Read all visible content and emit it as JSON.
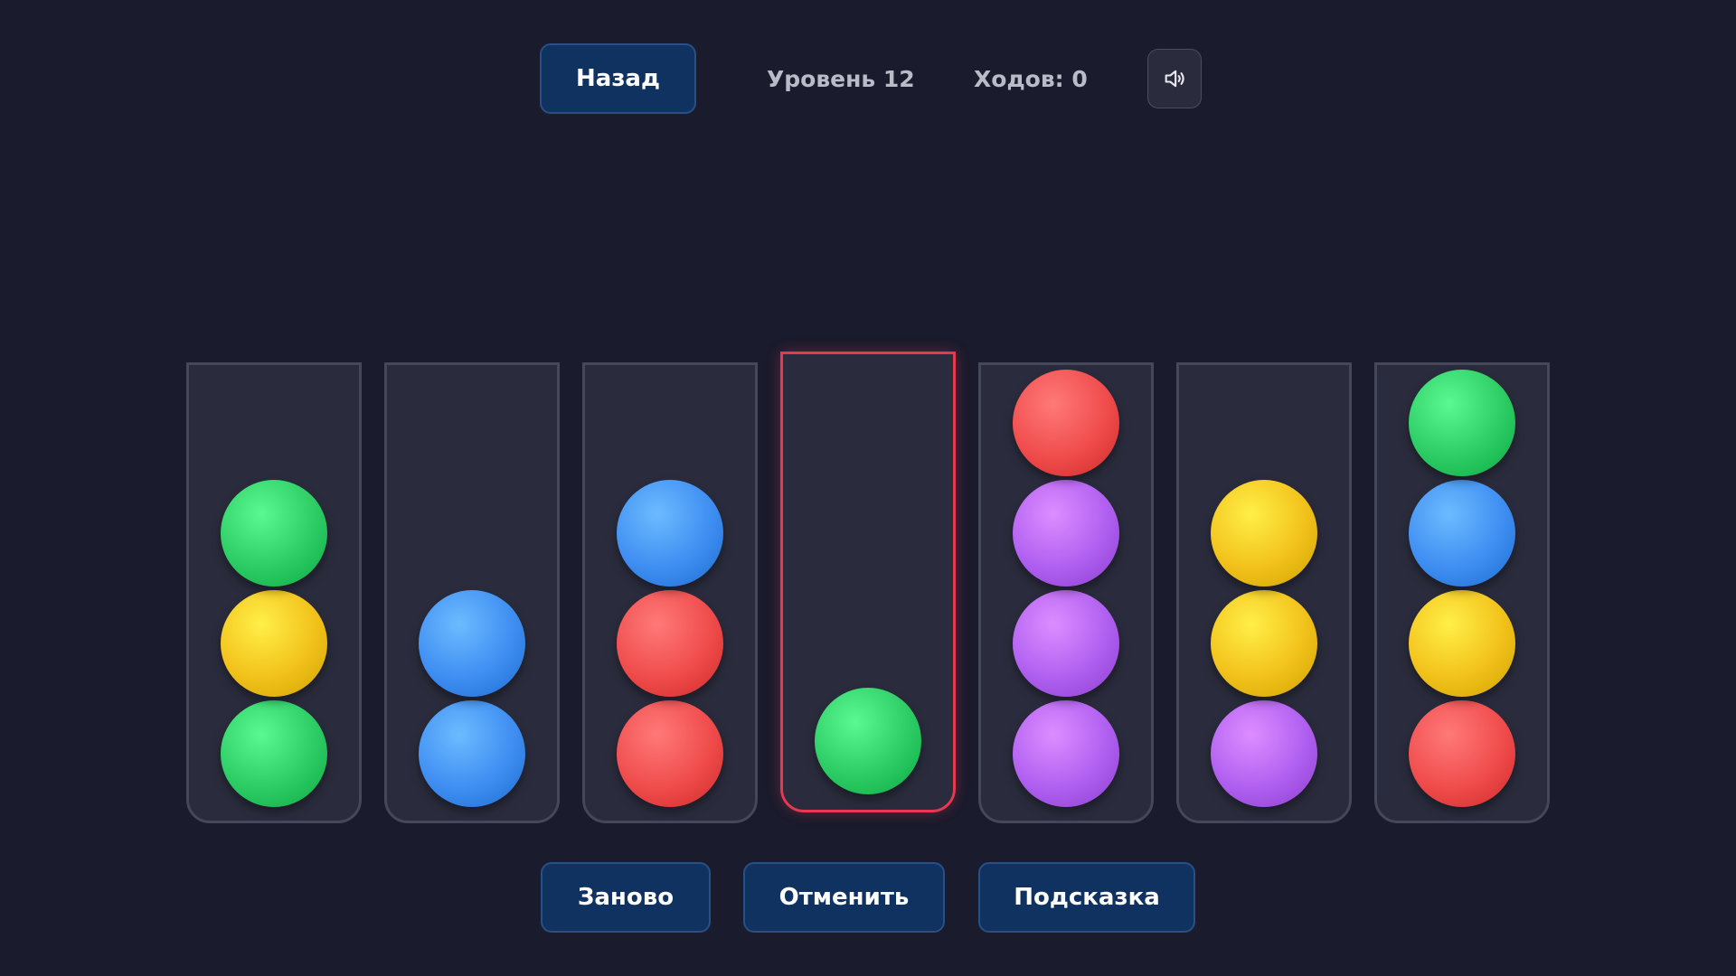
{
  "header": {
    "back_label": "Назад",
    "level_label": "Уровень 12",
    "moves_label": "Ходов: 0",
    "sound_icon": "speaker-icon"
  },
  "footer": {
    "restart_label": "Заново",
    "undo_label": "Отменить",
    "hint_label": "Подсказка"
  },
  "colors": {
    "green": "#2ecc64",
    "yellow": "#f2c21b",
    "blue": "#3f8ef2",
    "red": "#f04c4c",
    "purple": "#b060f0",
    "selected_border": "#e6384f"
  },
  "tubes": [
    {
      "balls": [
        "green",
        "yellow",
        "green"
      ],
      "selected": false
    },
    {
      "balls": [
        "blue",
        "blue"
      ],
      "selected": false
    },
    {
      "balls": [
        "red",
        "red",
        "blue"
      ],
      "selected": false
    },
    {
      "balls": [
        "green"
      ],
      "selected": true
    },
    {
      "balls": [
        "purple",
        "purple",
        "purple",
        "red"
      ],
      "selected": false
    },
    {
      "balls": [
        "purple",
        "yellow",
        "yellow"
      ],
      "selected": false
    },
    {
      "balls": [
        "red",
        "yellow",
        "blue",
        "green"
      ],
      "selected": false
    }
  ]
}
